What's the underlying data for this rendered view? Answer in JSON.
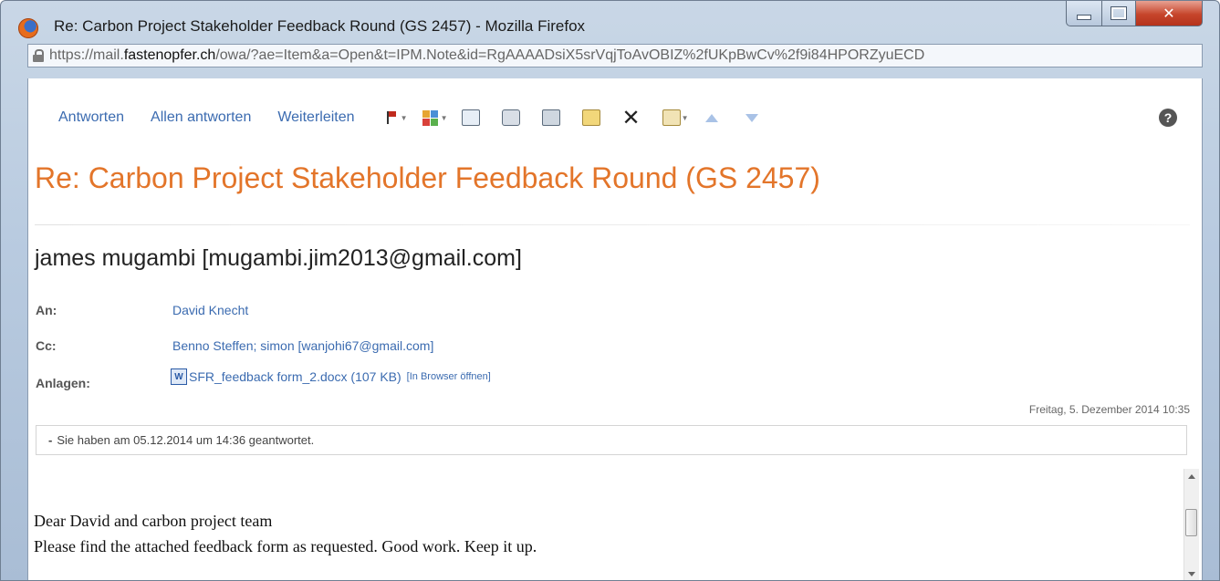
{
  "window": {
    "title": "Re: Carbon Project Stakeholder Feedback Round (GS 2457) - Mozilla Firefox"
  },
  "url": {
    "prefix": "https://mail.",
    "host": "fastenopfer.ch",
    "rest": "/owa/?ae=Item&a=Open&t=IPM.Note&id=RgAAAADsiX5srVqjToAvOBIZ%2fUKpBwCv%2f9i84HPORZyuECD"
  },
  "toolbar": {
    "reply_label": "Antworten",
    "reply_all_label": "Allen antworten",
    "forward_label": "Weiterleiten"
  },
  "message": {
    "subject": "Re: Carbon Project Stakeholder Feedback Round (GS 2457)",
    "sender": "james mugambi [mugambi.jim2013@gmail.com]",
    "to_label": "An:",
    "to_value": "David Knecht",
    "cc_label": "Cc:",
    "cc_value": "Benno Steffen; simon [wanjohi67@gmail.com]",
    "attachments_label": "Anlagen:",
    "attachment_name": "SFR_feedback form_2.docx (107 KB)",
    "attachment_open": "[In Browser öffnen]",
    "date": "Freitag, 5. Dezember 2014 10:35",
    "info_notice": "Sie haben am 05.12.2014 um 14:36 geantwortet.",
    "body_line1": "Dear David and carbon project team",
    "body_line2": "Please find the attached feedback form as requested. Good work. Keep it up."
  },
  "colors": {
    "subject": "#e3752a",
    "link": "#3b6bb0",
    "close_button": "#c6452b"
  }
}
